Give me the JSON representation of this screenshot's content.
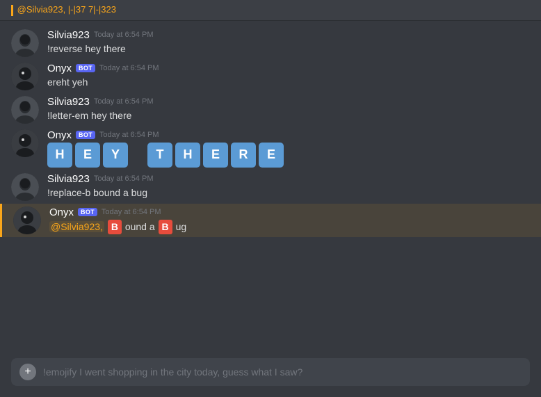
{
  "colors": {
    "background": "#36393f",
    "messageBg": "#36393f",
    "hoverBg": "#32353b",
    "highlightBg": "rgba(250,166,26,0.1)",
    "highlightBorder": "#faa61a",
    "inputBg": "#40444b",
    "botBadge": "#5865f2",
    "letterBox": "#5b9bd5",
    "replaceB": "#e74c3c",
    "mention": "#faa61a"
  },
  "topBar": {
    "text": "@Silvia923, |-|37 7|-|323"
  },
  "messages": [
    {
      "id": "msg1",
      "author": "Silvia923",
      "isBot": false,
      "timestamp": "Today at 6:54 PM",
      "text": "!reverse hey there",
      "type": "plain"
    },
    {
      "id": "msg2",
      "author": "Onyx",
      "isBot": true,
      "timestamp": "Today at 6:54 PM",
      "text": "ereht yeh",
      "type": "plain"
    },
    {
      "id": "msg3",
      "author": "Silvia923",
      "isBot": false,
      "timestamp": "Today at 6:54 PM",
      "text": "!letter-em hey there",
      "type": "plain"
    },
    {
      "id": "msg4",
      "author": "Onyx",
      "isBot": true,
      "timestamp": "Today at 6:54 PM",
      "letters": [
        "H",
        "E",
        "Y",
        "",
        "T",
        "H",
        "E",
        "R",
        "E"
      ],
      "type": "letters"
    },
    {
      "id": "msg5",
      "author": "Silvia923",
      "isBot": false,
      "timestamp": "Today at 6:54 PM",
      "text": "!replace-b bound a bug",
      "type": "plain"
    },
    {
      "id": "msg6",
      "author": "Onyx",
      "isBot": true,
      "timestamp": "Today at 6:54 PM",
      "type": "replace-b",
      "mention": "@Silvia923,",
      "parts": [
        "ound a ",
        "ug"
      ],
      "highlighted": true
    }
  ],
  "input": {
    "placeholder": "!emojify I went shopping in the city today, guess what I saw?",
    "value": "!emojify I went shopping in the city today, guess what I saw?"
  },
  "addButtonLabel": "+"
}
